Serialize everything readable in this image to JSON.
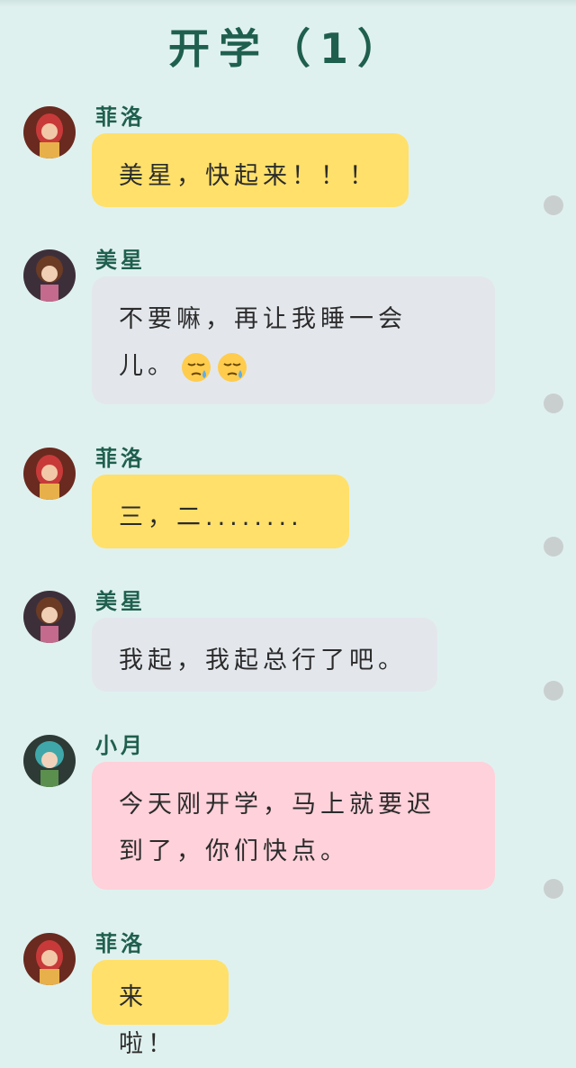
{
  "title": "开学（1）",
  "messages": [
    {
      "sender": "菲洛",
      "text": "美星，快起来！！！"
    },
    {
      "sender": "美星",
      "text_line1": "不要嘛，再让我睡一会",
      "text_line2": "儿。"
    },
    {
      "sender": "菲洛",
      "text": "三，二........"
    },
    {
      "sender": "美星",
      "text": "我起，我起总行了吧。"
    },
    {
      "sender": "小月",
      "text_line1": "今天刚开学，马上就要迟",
      "text_line2": "到了，你们快点。"
    },
    {
      "sender": "菲洛",
      "text": "来啦！"
    }
  ],
  "colors": {
    "background": "#dff1ef",
    "title": "#1f5f4d",
    "yellow_bubble": "#ffe06a",
    "gray_bubble": "#e3e7ec",
    "pink_bubble": "#ffd1da",
    "indicator_dot": "#c9cfcf"
  },
  "icons": {
    "sleepy_emoji": "sleepy-face-icon"
  }
}
